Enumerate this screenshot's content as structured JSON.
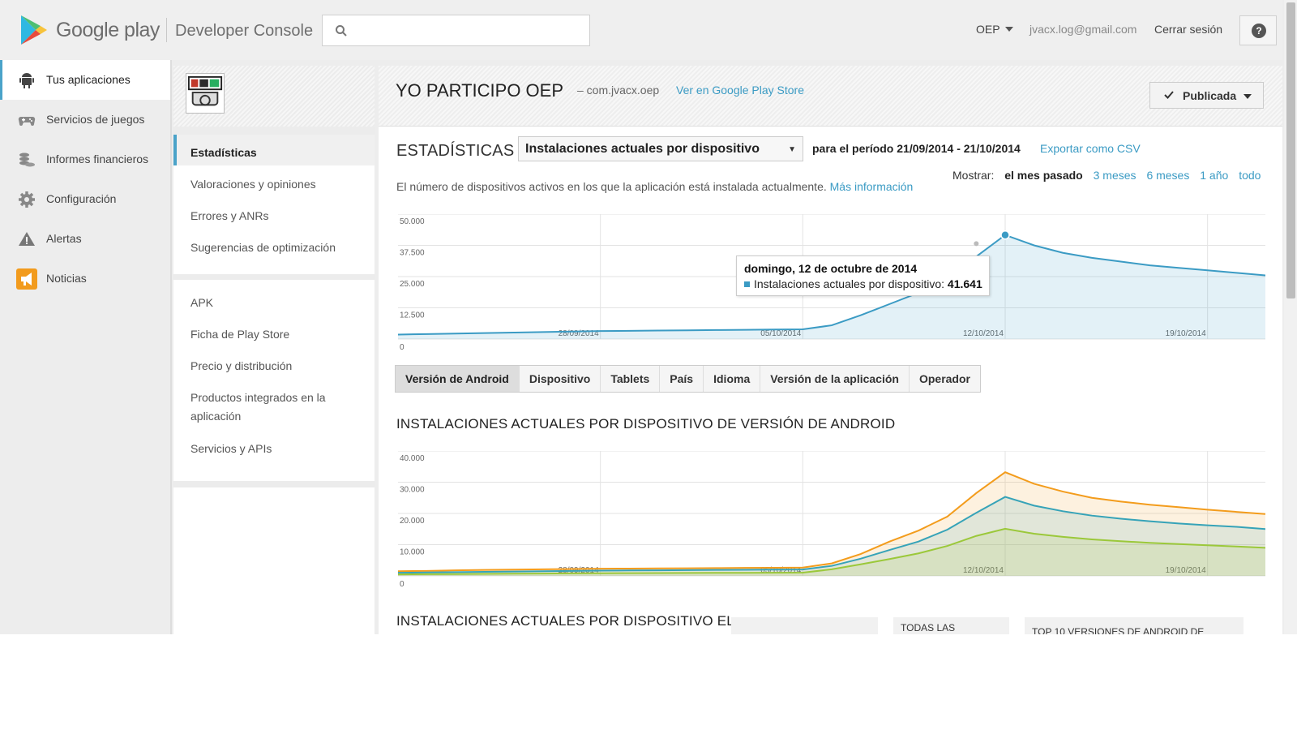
{
  "header": {
    "brand": "Google play",
    "product": "Developer Console",
    "search_placeholder": "",
    "account": "OEP",
    "email": "jvacx.log@gmail.com",
    "logout": "Cerrar sesión",
    "help": "?"
  },
  "leftnav": {
    "items": [
      {
        "label": "Tus aplicaciones",
        "icon": "android-icon"
      },
      {
        "label": "Servicios de juegos",
        "icon": "gamepad-icon"
      },
      {
        "label": "Informes financieros",
        "icon": "coins-icon"
      },
      {
        "label": "Configuración",
        "icon": "gear-icon"
      },
      {
        "label": "Alertas",
        "icon": "warning-icon"
      },
      {
        "label": "Noticias",
        "icon": "megaphone-icon"
      }
    ]
  },
  "subnav": {
    "group1": [
      "Estadísticas",
      "Valoraciones y opiniones",
      "Errores y ANRs",
      "Sugerencias de optimización"
    ],
    "group2": [
      "APK",
      "Ficha de Play Store",
      "Precio y distribución",
      "Productos integrados en la aplicación",
      "Servicios y APIs"
    ]
  },
  "app": {
    "title": "YO PARTICIPO OEP",
    "package": "– com.jvacx.oep",
    "store_link": "Ver en Google Play Store",
    "status": "Publicada"
  },
  "stats": {
    "heading": "ESTADÍSTICAS",
    "metric": "Instalaciones actuales por dispositivo",
    "period": "para el período 21/09/2014 - 21/10/2014",
    "export": "Exportar como CSV",
    "description": "El número de dispositivos activos en los que la aplicación está instalada actualmente.",
    "more_info": "Más información",
    "show_label": "Mostrar:",
    "ranges": [
      "el mes pasado",
      "3 meses",
      "6 meses",
      "1 año",
      "todo"
    ]
  },
  "tooltip": {
    "date": "domingo, 12 de octubre de 2014",
    "series": "Instalaciones actuales por dispositivo:",
    "value": "41.641"
  },
  "tabs": [
    "Versión de Android",
    "Dispositivo",
    "Tablets",
    "País",
    "Idioma",
    "Versión de la aplicación",
    "Operador"
  ],
  "section2_title": "INSTALACIONES ACTUALES POR DISPOSITIVO DE VERSIÓN DE ANDROID",
  "section3_title": "INSTALACIONES ACTUALES POR DISPOSITIVO EL",
  "section3_boxes": [
    "",
    "TODAS LAS",
    "TOP 10 VERSIONES DE ANDROID DE"
  ],
  "colors": {
    "accent": "#3b9bc4",
    "series_blue": "#3b9bc4",
    "series_orange": "#f39c1c",
    "series_teal": "#36a3b8",
    "series_green": "#9bc83a"
  },
  "chart_data": [
    {
      "type": "area",
      "x": [
        "21/09",
        "22/09",
        "23/09",
        "24/09",
        "25/09",
        "26/09",
        "27/09",
        "28/09",
        "29/09",
        "30/09",
        "01/10",
        "02/10",
        "03/10",
        "04/10",
        "05/10",
        "06/10",
        "07/10",
        "08/10",
        "09/10",
        "10/10",
        "11/10",
        "12/10",
        "13/10",
        "14/10",
        "15/10",
        "16/10",
        "17/10",
        "18/10",
        "19/10",
        "20/10",
        "21/10"
      ],
      "xticks": [
        "28/09/2014",
        "05/10/2014",
        "12/10/2014",
        "19/10/2014"
      ],
      "yticks": [
        "50.000",
        "37.500",
        "25.000",
        "12.500",
        "0"
      ],
      "ylim": [
        0,
        50000
      ],
      "series": [
        {
          "values": [
            1800,
            2000,
            2200,
            2400,
            2600,
            2800,
            3000,
            3200,
            3300,
            3400,
            3500,
            3600,
            3700,
            3800,
            3900,
            5500,
            9500,
            14000,
            18500,
            24500,
            33000,
            41641,
            37500,
            34500,
            32500,
            31000,
            29500,
            28500,
            27500,
            26500,
            25500
          ]
        }
      ]
    },
    {
      "type": "area",
      "xticks": [
        "28/09/2014",
        "05/10/2014",
        "12/10/2014",
        "19/10/2014"
      ],
      "yticks": [
        "40.000",
        "30.000",
        "20.000",
        "10.000",
        "0"
      ],
      "ylim": [
        0,
        40000
      ],
      "series": [
        {
          "values": [
            1500,
            1600,
            1800,
            1900,
            2000,
            2100,
            2200,
            2300,
            2350,
            2400,
            2450,
            2500,
            2550,
            2600,
            2650,
            4000,
            7000,
            11000,
            14500,
            19000,
            26500,
            33200,
            29500,
            27000,
            25000,
            23800,
            22800,
            22000,
            21200,
            20500,
            19800
          ]
        },
        {
          "values": [
            1000,
            1100,
            1200,
            1300,
            1400,
            1500,
            1600,
            1700,
            1750,
            1800,
            1850,
            1900,
            1950,
            2000,
            2050,
            3200,
            5500,
            8300,
            11000,
            14800,
            20200,
            25300,
            22500,
            20700,
            19300,
            18300,
            17500,
            16800,
            16200,
            15700,
            15000
          ]
        },
        {
          "values": [
            500,
            550,
            600,
            650,
            700,
            750,
            800,
            850,
            880,
            900,
            930,
            960,
            990,
            1020,
            1050,
            2100,
            3700,
            5400,
            7200,
            9600,
            12800,
            15100,
            13500,
            12500,
            11700,
            11100,
            10600,
            10200,
            9800,
            9400,
            9000
          ]
        }
      ]
    }
  ]
}
